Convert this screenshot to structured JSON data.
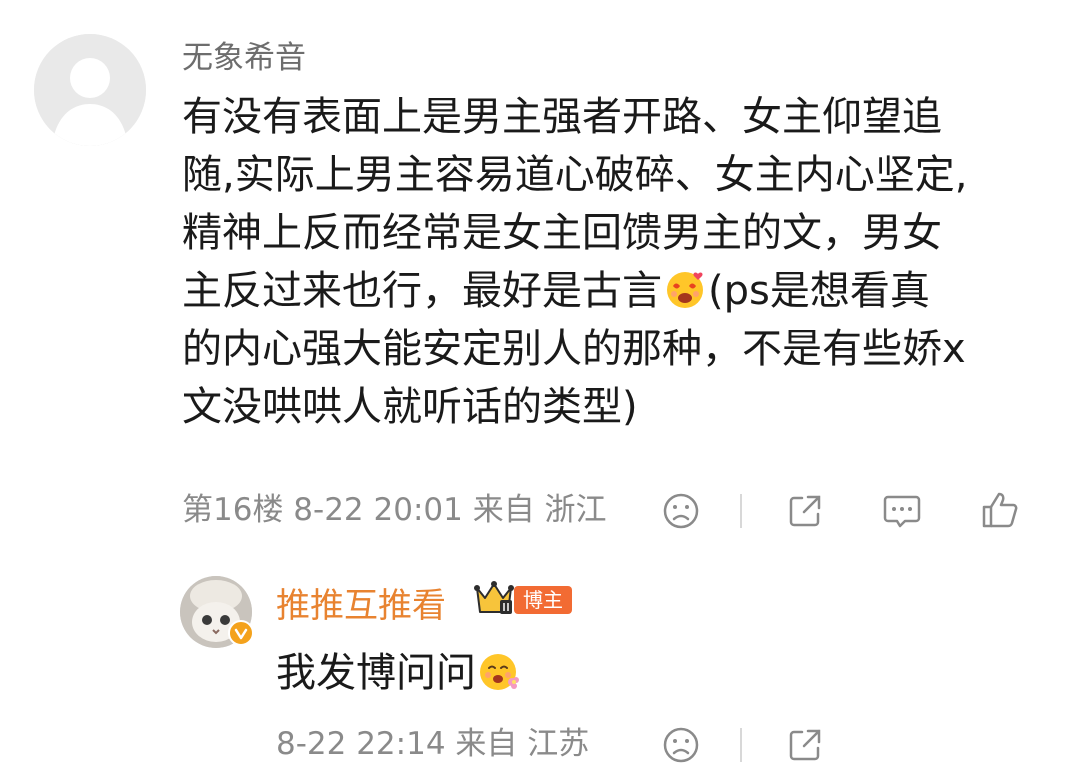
{
  "comment": {
    "username": "无象希音",
    "lines": [
      "有没有表面上是男主强者开路、女主仰望追",
      "随,实际上男主容易道心破碎、女主内心坚定,",
      "精神上反而经常是女主回馈男主的文，男女",
      "主反过来也行，最好是古言",
      "(ps是想看真",
      "的内心强大能安定别人的那种，不是有些娇x",
      "文没哄哄人就听话的类型)"
    ],
    "emoji_icon": "heart-eyes-emoji-icon",
    "meta": "第16楼 8-22 20:01 来自 浙江",
    "actions": [
      "frown-icon",
      "share-icon",
      "comment-icon",
      "like-icon"
    ]
  },
  "reply": {
    "username": "推推互推看",
    "badge": "博主",
    "text": "我发博问问",
    "emoji_icon": "flower-blush-emoji-icon",
    "meta": "8-22 22:14 来自 江苏",
    "actions": [
      "frown-icon",
      "share-icon"
    ]
  },
  "colors": {
    "username_gray": "#6d6d6d",
    "meta_gray": "#8a8a8a",
    "blogger_orange": "#e88330",
    "badge_bg": "#f26b33",
    "verify_orange": "#f4a21c"
  }
}
